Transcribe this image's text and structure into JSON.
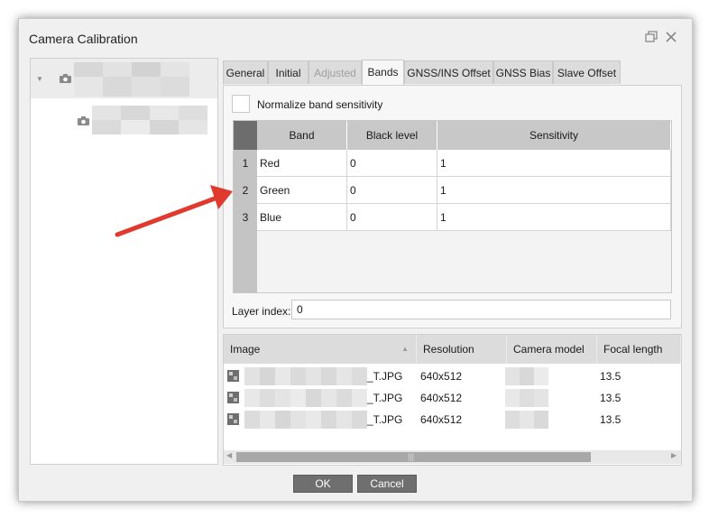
{
  "window": {
    "title": "Camera Calibration"
  },
  "tabs": [
    "General",
    "Initial",
    "Adjusted",
    "Bands",
    "GNSS/INS Offset",
    "GNSS Bias",
    "Slave Offset"
  ],
  "active_tab": "Bands",
  "disabled_tabs": [
    "Adjusted"
  ],
  "bands": {
    "normalize_label": "Normalize band sensitivity",
    "normalize_checked": false,
    "columns": [
      "Band",
      "Black level",
      "Sensitivity"
    ],
    "rows": [
      {
        "num": "1",
        "band": "Red",
        "black_level": "0",
        "sensitivity": "1"
      },
      {
        "num": "2",
        "band": "Green",
        "black_level": "0",
        "sensitivity": "1"
      },
      {
        "num": "3",
        "band": "Blue",
        "black_level": "0",
        "sensitivity": "1"
      }
    ],
    "layer_index_label": "Layer index:",
    "layer_index_value": "0"
  },
  "images": {
    "columns": [
      "Image",
      "Resolution",
      "Camera model",
      "Focal length"
    ],
    "rows": [
      {
        "name_suffix": "_T.JPG",
        "resolution": "640x512",
        "focal_length": "13.5"
      },
      {
        "name_suffix": "_T.JPG",
        "resolution": "640x512",
        "focal_length": "13.5"
      },
      {
        "name_suffix": "_T.JPG",
        "resolution": "640x512",
        "focal_length": "13.5"
      }
    ]
  },
  "buttons": {
    "ok": "OK",
    "cancel": "Cancel"
  },
  "colors": {
    "annotation_arrow": "#e03a2f",
    "button_bg": "#6f6f6f",
    "grid_header": "#c8c8c8"
  }
}
